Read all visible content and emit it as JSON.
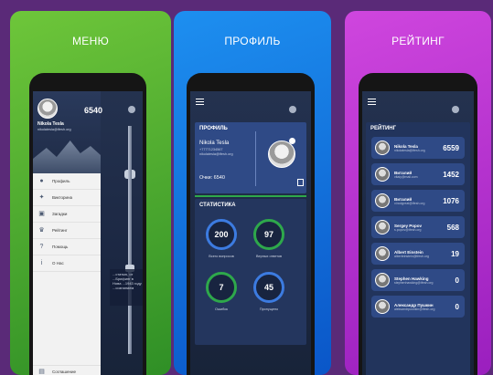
{
  "panels": {
    "menu": {
      "title": "МЕНЮ",
      "score": "6540",
      "user_name": "Nikola Tesla",
      "user_email": "nikolatesla@tfesh.org",
      "items": [
        {
          "label": "Профиль",
          "icon": "person-icon"
        },
        {
          "label": "Викторина",
          "icon": "quiz-icon"
        },
        {
          "label": "Загадки",
          "icon": "puzzle-icon"
        },
        {
          "label": "Рейтинг",
          "icon": "trophy-icon"
        },
        {
          "label": "Помощь",
          "icon": "help-icon"
        },
        {
          "label": "О Нас",
          "icon": "info-icon"
        }
      ],
      "bottom_item": "Соглашение",
      "toast_text": "...статью, от ...Брифинг в Нова ...1943 году ...сознанием"
    },
    "profile": {
      "title": "ПРОФИЛЬ",
      "card_title": "ПРОФИЛЬ",
      "name": "Nikola Tesla",
      "phone": "+77771234567",
      "email": "nikolatesla@tfesh.org",
      "points": "Очки: 6540",
      "stats_title": "СТАТИСТИКА",
      "stats": [
        {
          "value": "200",
          "label": "Всего вопросов",
          "color": "#3c7be0"
        },
        {
          "value": "97",
          "label": "Верных ответов",
          "color": "#2ea84b"
        },
        {
          "value": "7",
          "label": "Ошибок",
          "color": "#2ea84b"
        },
        {
          "value": "45",
          "label": "Пропущено",
          "color": "#3c7be0"
        }
      ]
    },
    "rating": {
      "title": "РЕЙТИНГ",
      "header": "РЕЙТИНГ",
      "rows": [
        {
          "name": "Nikola Tesla",
          "email": "nikolatesla@tfesh.org",
          "score": "6559"
        },
        {
          "name": "Виталий",
          "email": "vitaly@mail.com",
          "score": "1452"
        },
        {
          "name": "Виталий",
          "email": "v.bodgreat@tfesh.org",
          "score": "1076"
        },
        {
          "name": "Sergey Popov",
          "email": "s.popov@tfesh.org",
          "score": "568"
        },
        {
          "name": "Albert Einstein",
          "email": "alberteinstein@tfesh.org",
          "score": "19"
        },
        {
          "name": "Stephen Hawking",
          "email": "stephenhawking@tfesh.org",
          "score": "0"
        },
        {
          "name": "Александр Пушкин",
          "email": "aleksandrpushkin@tfesh.org",
          "score": "0"
        }
      ]
    }
  }
}
